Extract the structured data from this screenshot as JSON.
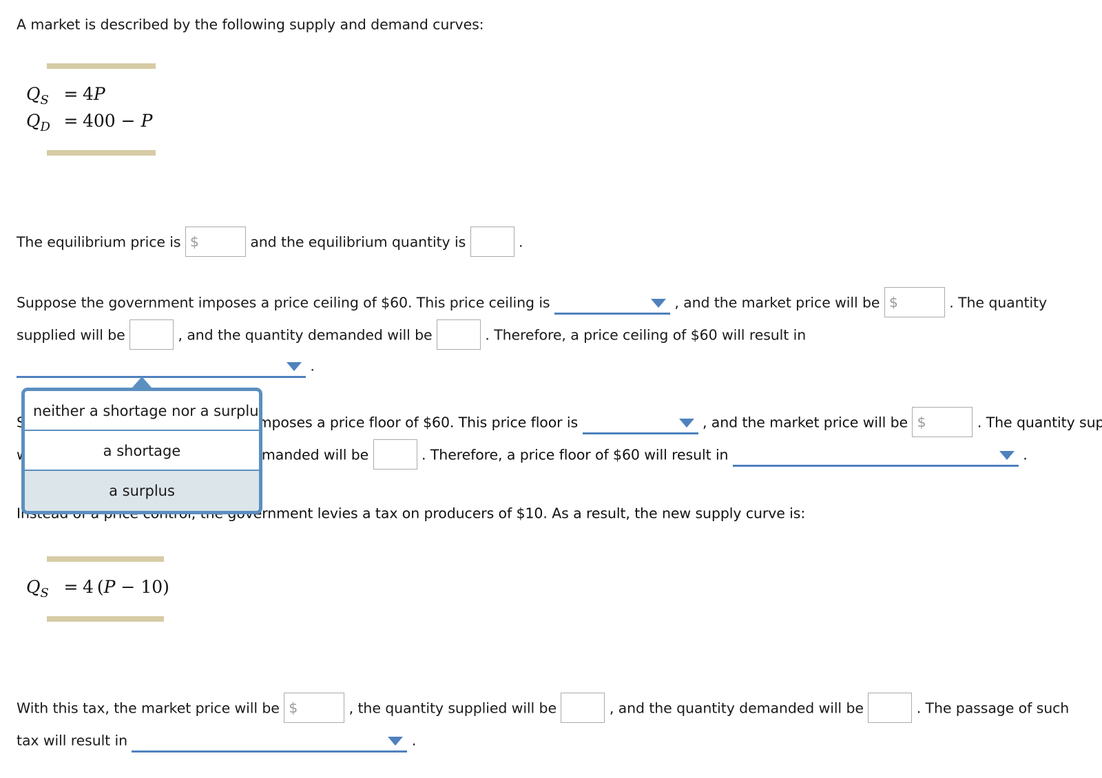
{
  "intro": {
    "text": "A market is described by the following supply and demand curves:"
  },
  "equations": {
    "supply": {
      "lhs": "Q",
      "sub": "S",
      "eq": "=",
      "rhs_html": "4P",
      "rhs": "4P"
    },
    "demand": {
      "lhs": "Q",
      "sub": "D",
      "eq": "=",
      "rhs": "400 − P"
    },
    "supply_taxed": {
      "lhs": "Q",
      "sub": "S",
      "eq": "=",
      "rhs": "4 (P − 10)"
    }
  },
  "equilibrium": {
    "lead": "The equilibrium price is",
    "mid": "and the equilibrium quantity is",
    "tail": ".",
    "price_value": "",
    "price_prefix": "$",
    "quantity_value": ""
  },
  "ceiling": {
    "line1_a": "Suppose the government imposes a price ceiling of $60. This price ceiling is",
    "line1_b": ", and the market price will be",
    "line1_c": ". The quantity",
    "line2_a": "supplied will be",
    "line2_b": ", and the quantity demanded will be",
    "line2_c": ". Therefore, a price ceiling of $60 will result in",
    "line3_tail": ".",
    "price_prefix": "$",
    "price_value": "",
    "qs_value": "",
    "qd_value": ""
  },
  "floor": {
    "line1_a": "Suppose instead the government imposes a price floor of $60. This price floor is",
    "line1_b": ", and the market price will be",
    "line1_c": ". The quantity supplied",
    "line2_a": "will be",
    "line2_b": ", and the quantity demanded will be",
    "line2_c": ". Therefore, a price floor of $60 will result in",
    "line2_tail": ".",
    "price_prefix": "$",
    "price_value": "",
    "qs_value": "",
    "qd_value": ""
  },
  "tax_intro": {
    "text": "Instead of a price control, the government levies a tax on producers of $10. As a result, the new supply curve is:"
  },
  "tax_result": {
    "line1_a": "With this tax, the market price will be",
    "line1_b": ", the quantity supplied will be",
    "line1_c": ", and the quantity demanded will be",
    "line1_d": ". The passage of such",
    "line2_a": "tax will result in",
    "line2_tail": ".",
    "price_prefix": "$",
    "price_value": "",
    "qs_value": "",
    "qd_value": ""
  },
  "dropdown_popup": {
    "options": [
      {
        "label": "neither a shortage nor a surplus",
        "selected": false
      },
      {
        "label": "a shortage",
        "selected": false
      },
      {
        "label": "a surplus",
        "selected": true
      }
    ]
  },
  "colors": {
    "accent_blue": "#4f81bd",
    "popup_border": "#5b8fc0",
    "popup_highlight": "#dce5ea",
    "rule_tan": "#d6cba4",
    "input_border": "#aaaaaa",
    "placeholder_gray": "#9a9a9a",
    "text": "#1a1a1a"
  },
  "icons": {
    "caret_down": "▼",
    "caret_up": "▲"
  }
}
